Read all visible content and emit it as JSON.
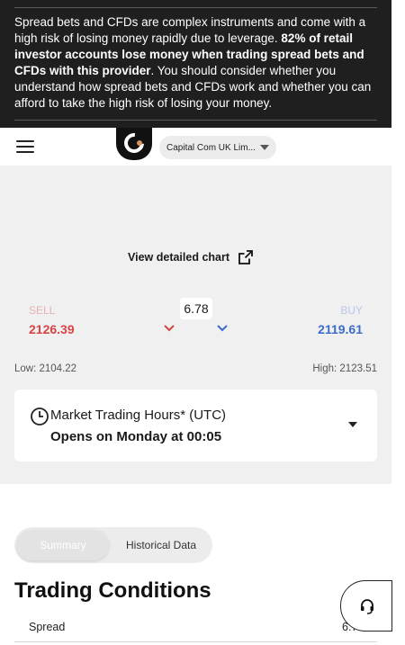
{
  "risk_warning": {
    "text_a": "Spread bets and CFDs are complex instruments and come with a high risk of losing money rapidly due to leverage. ",
    "text_bold": "82% of retail investor accounts lose money when trading spread bets and CFDs with this provider",
    "text_b": ". You should consider whether you understand how spread bets and CFDs work and whether you can afford to take the high risk of losing your money."
  },
  "header": {
    "entity_select": "Capital Com UK Lim..."
  },
  "chart": {
    "link_label": "View detailed chart"
  },
  "quote": {
    "sell_label": "SELL",
    "sell_price": "2126.39",
    "buy_label": "BUY",
    "buy_price": "2119.61",
    "spread": "6.78",
    "low": "Low: 2104.22",
    "high": "High: 2123.51"
  },
  "trading_hours": {
    "title": "Market Trading Hours* (UTC)",
    "status": "Opens on Monday at 00:05"
  },
  "tabs": [
    {
      "label": "Summary"
    },
    {
      "label": "Historical Data"
    }
  ],
  "trading_conditions": {
    "title": "Trading Conditions",
    "rows": [
      {
        "label": "Spread",
        "value": "6.78"
      }
    ]
  },
  "colors": {
    "sell": "#d64545",
    "buy": "#3d6cc8",
    "banner": "#1f1f1f"
  },
  "icons": [
    "menu-icon",
    "logo",
    "caret-down-icon",
    "external-link-icon",
    "chevron-down-icon",
    "clock-icon",
    "headset-icon"
  ]
}
